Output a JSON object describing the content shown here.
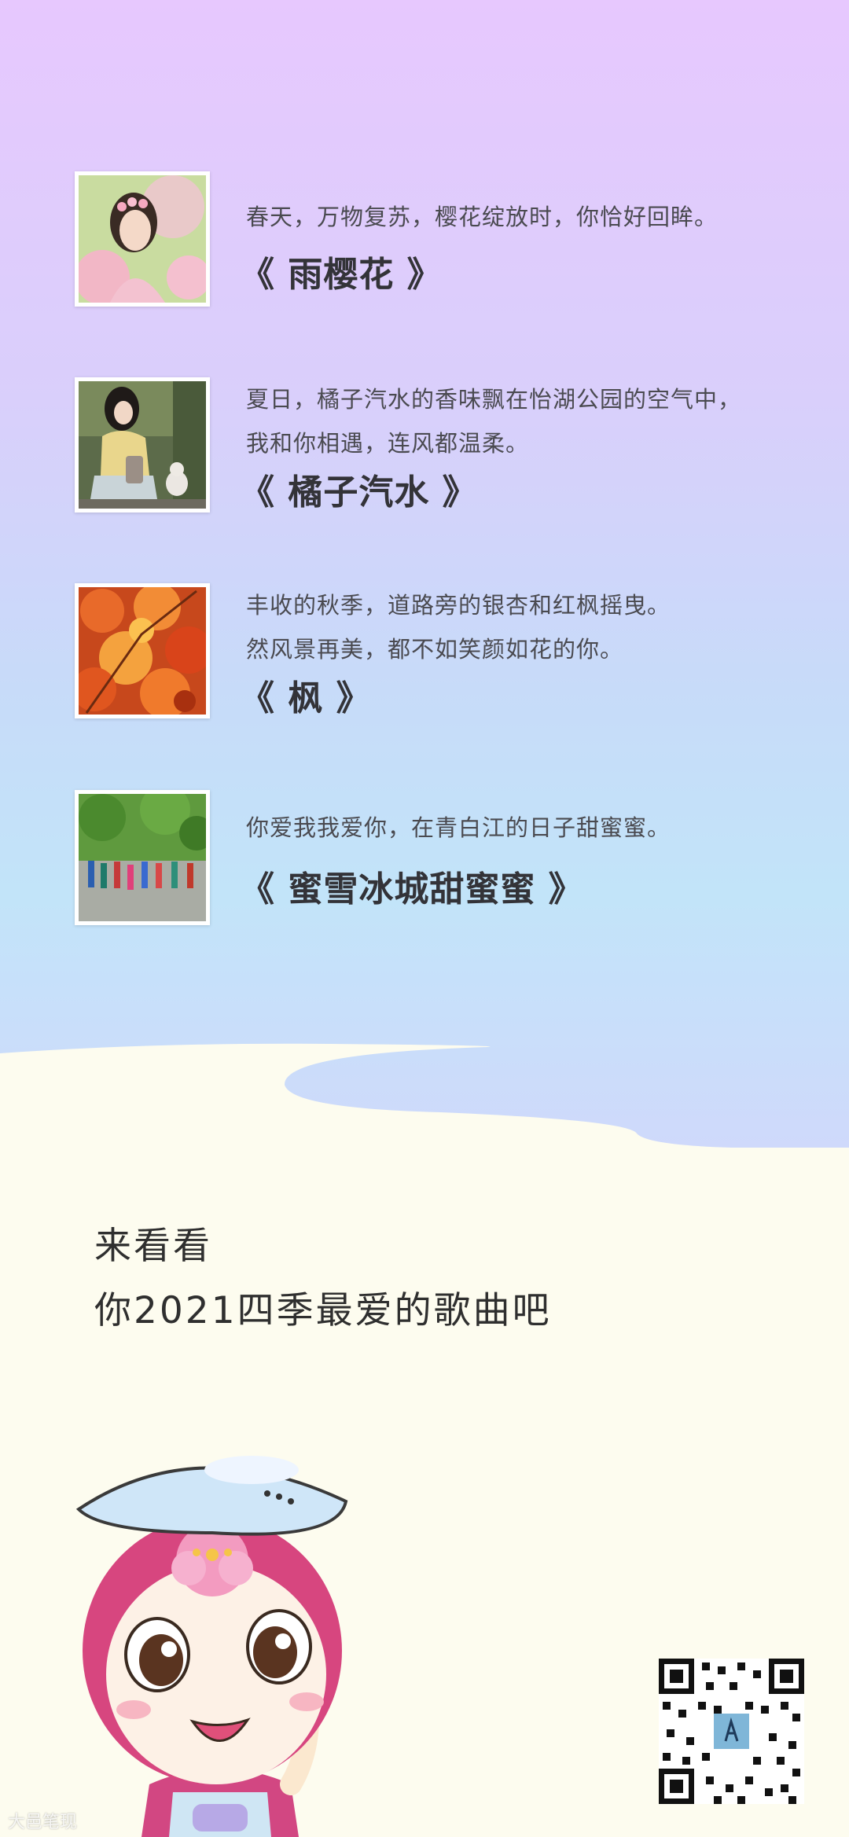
{
  "entries": [
    {
      "lines": [
        "春天，万物复苏，樱花绽放时，你恰好回眸。"
      ],
      "title": "《 雨樱花 》"
    },
    {
      "lines": [
        "夏日，橘子汽水的香味飘在怡湖公园的空气中，",
        "我和你相遇，连风都温柔。"
      ],
      "title": "《 橘子汽水 》"
    },
    {
      "lines": [
        "丰收的秋季，道路旁的银杏和红枫摇曳。",
        "然风景再美，都不如笑颜如花的你。"
      ],
      "title": "《 枫 》"
    },
    {
      "lines": [
        "你爱我我爱你，在青白江的日子甜蜜蜜。"
      ],
      "title": "《 蜜雪冰城甜蜜蜜 》"
    }
  ],
  "heading": {
    "line1": "来看看",
    "line2": "你2021四季最爱的歌曲吧"
  },
  "watermark": "大邑笔现"
}
